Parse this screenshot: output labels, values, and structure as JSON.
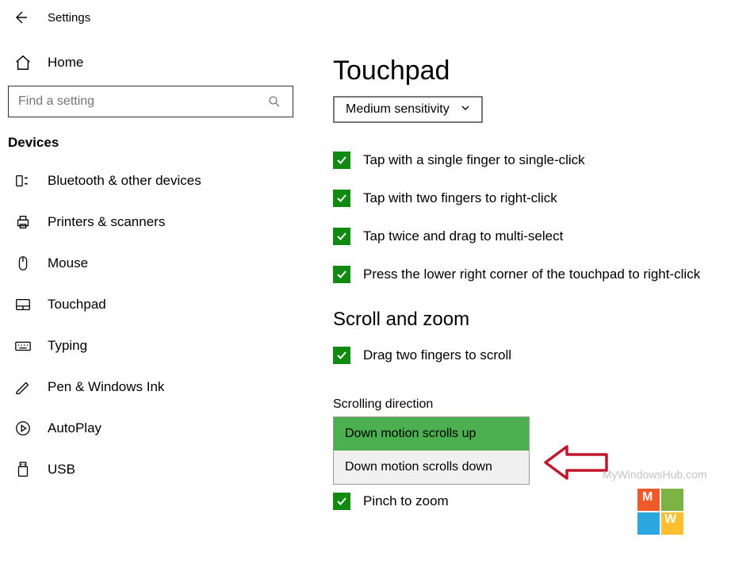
{
  "header": {
    "title": "Settings"
  },
  "sidebar": {
    "home": "Home",
    "search_placeholder": "Find a setting",
    "section": "Devices",
    "items": [
      {
        "label": "Bluetooth & other devices"
      },
      {
        "label": "Printers & scanners"
      },
      {
        "label": "Mouse"
      },
      {
        "label": "Touchpad"
      },
      {
        "label": "Typing"
      },
      {
        "label": "Pen & Windows Ink"
      },
      {
        "label": "AutoPlay"
      },
      {
        "label": "USB"
      }
    ]
  },
  "content": {
    "heading": "Touchpad",
    "sensitivity": "Medium sensitivity",
    "taps": [
      "Tap with a single finger to single-click",
      "Tap with two fingers to right-click",
      "Tap twice and drag to multi-select",
      "Press the lower right corner of the touchpad to right-click"
    ],
    "scroll_heading": "Scroll and zoom",
    "scroll_check": "Drag two fingers to scroll",
    "direction_label": "Scrolling direction",
    "direction_options": [
      "Down motion scrolls up",
      "Down motion scrolls down"
    ],
    "pinch": "Pinch to zoom"
  },
  "watermark": "MyWindowsHub.com"
}
